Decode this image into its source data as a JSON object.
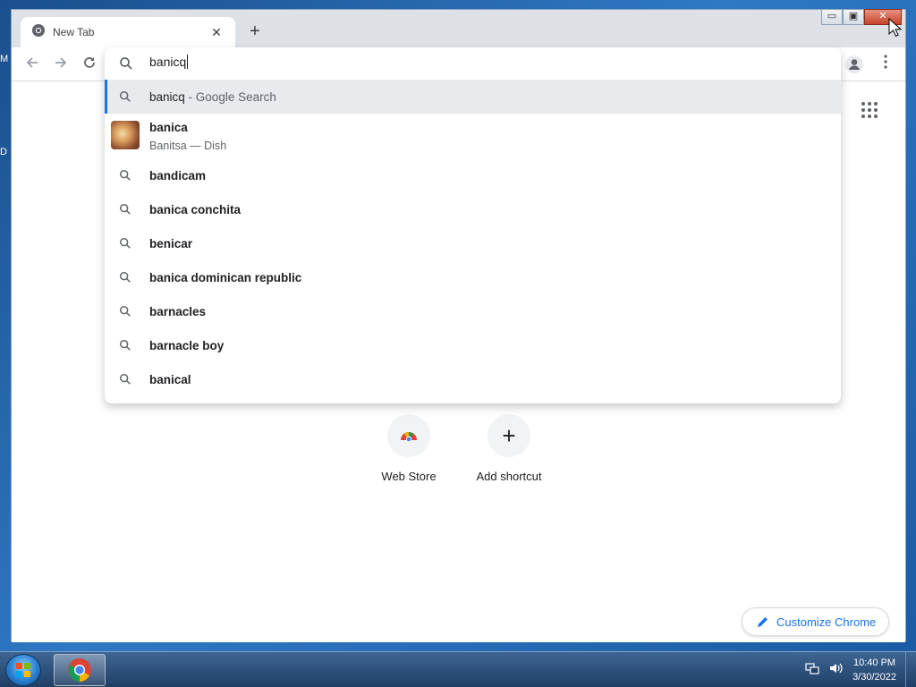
{
  "desktop": {
    "edge_letter_1": "M",
    "edge_letter_2": "D"
  },
  "browser": {
    "tab": {
      "title": "New Tab"
    },
    "new_tab_symbol": "+",
    "window_controls": {
      "minimize": "▭",
      "maximize": "▣",
      "close": "✕"
    }
  },
  "omnibox": {
    "input_value": "banicq",
    "selected": {
      "query": "banicq",
      "separator": " - ",
      "suffix": "Google Search"
    },
    "entity": {
      "title": "banica",
      "subtitle": "Banitsa — Dish"
    },
    "suggestions": [
      "bandicam",
      "banica conchita",
      "benicar",
      "banica dominican republic",
      "barnacles",
      "barnacle boy",
      "banical"
    ]
  },
  "shortcuts": [
    {
      "label": "Web Store"
    },
    {
      "label": "Add shortcut",
      "symbol": "+"
    }
  ],
  "customize": {
    "label": "Customize Chrome"
  },
  "taskbar": {
    "time": "10:40 PM",
    "date": "3/30/2022"
  },
  "colors": {
    "accent": "#1a73e8",
    "selected_row": "#e8eaed",
    "close_button": "#c7432a"
  }
}
